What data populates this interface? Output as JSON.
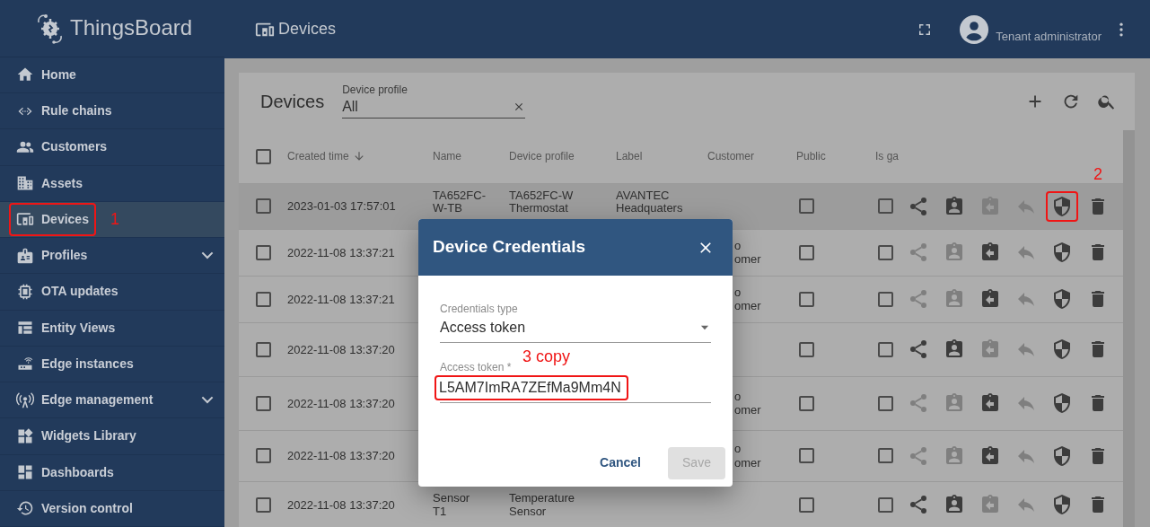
{
  "sidebar": {
    "brand": "ThingsBoard",
    "items": [
      {
        "label": "Home",
        "selected": false
      },
      {
        "label": "Rule chains",
        "selected": false
      },
      {
        "label": "Customers",
        "selected": false
      },
      {
        "label": "Assets",
        "selected": false
      },
      {
        "label": "Devices",
        "selected": true,
        "annotation": "1"
      },
      {
        "label": "Profiles",
        "selected": false,
        "expanded": false
      },
      {
        "label": "OTA updates",
        "selected": false
      },
      {
        "label": "Entity Views",
        "selected": false
      },
      {
        "label": "Edge instances",
        "selected": false
      },
      {
        "label": "Edge management",
        "selected": false,
        "expanded": false
      },
      {
        "label": "Widgets Library",
        "selected": false
      },
      {
        "label": "Dashboards",
        "selected": false
      },
      {
        "label": "Version control",
        "selected": false
      }
    ]
  },
  "topbar": {
    "title": "Devices",
    "role": "Tenant administrator"
  },
  "card": {
    "title": "Devices",
    "filter": {
      "label": "Device profile",
      "value": "All"
    },
    "table": {
      "columns": [
        "Created time",
        "Name",
        "Device profile",
        "Label",
        "Customer",
        "Public",
        "Is ga"
      ],
      "all_selected": false,
      "rows": [
        {
          "created": "2023-01-03 17:57:01",
          "name": [
            "TA652FC-",
            "W-TB"
          ],
          "profile": [
            "TA652FC-W",
            "Thermostat"
          ],
          "label": [
            "AVANTEC",
            "Headquaters"
          ],
          "selected": false,
          "public": false,
          "gateway": false,
          "assigned": false,
          "hovered": true,
          "annotation": "2"
        },
        {
          "created": "2022-11-08 13:37:21",
          "customer": [
            "o",
            "omer"
          ],
          "selected": false,
          "public": false,
          "gateway": false,
          "assigned": true,
          "hovered": false
        },
        {
          "created": "2022-11-08 13:37:21",
          "customer": [
            "o",
            "omer"
          ],
          "selected": false,
          "public": false,
          "gateway": false,
          "assigned": true,
          "hovered": false
        },
        {
          "created": "2022-11-08 13:37:20",
          "selected": false,
          "public": false,
          "gateway": false,
          "assigned": false,
          "hovered": false
        },
        {
          "created": "2022-11-08 13:37:20",
          "customer": [
            "o",
            "omer"
          ],
          "selected": false,
          "public": false,
          "gateway": false,
          "assigned": true,
          "hovered": false
        },
        {
          "created": "2022-11-08 13:37:20",
          "customer": [
            "o",
            "omer"
          ],
          "selected": false,
          "public": false,
          "gateway": false,
          "assigned": true,
          "hovered": false
        },
        {
          "created": "2022-11-08 13:37:20",
          "name": [
            "Sensor",
            "T1"
          ],
          "profile": [
            "Temperature",
            "Sensor"
          ],
          "selected": false,
          "public": false,
          "gateway": false,
          "assigned": false,
          "hovered": false
        }
      ]
    }
  },
  "dialog": {
    "title": "Device Credentials",
    "type_label": "Credentials type",
    "type_value": "Access token",
    "token_label": "Access token *",
    "token_value": "L5AM7ImRA7ZEfMa9Mm4N",
    "token_annotation": "3 copy",
    "buttons": [
      {
        "label": "Cancel",
        "disabled": false
      },
      {
        "label": "Save",
        "disabled": true
      }
    ]
  }
}
